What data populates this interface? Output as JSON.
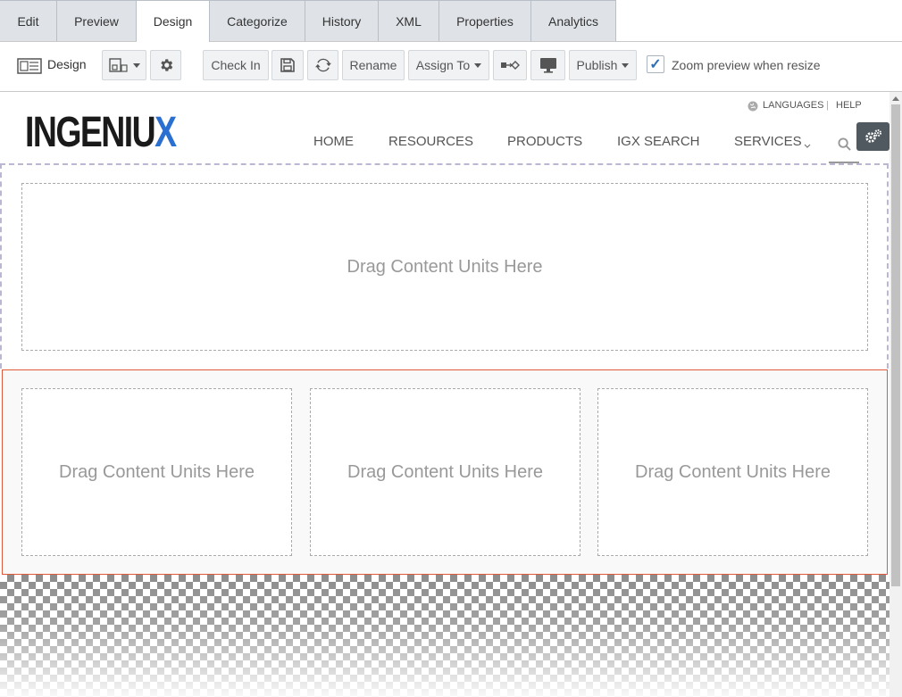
{
  "tabs": [
    {
      "label": "Edit",
      "active": false
    },
    {
      "label": "Preview",
      "active": false
    },
    {
      "label": "Design",
      "active": true
    },
    {
      "label": "Categorize",
      "active": false
    },
    {
      "label": "History",
      "active": false
    },
    {
      "label": "XML",
      "active": false
    },
    {
      "label": "Properties",
      "active": false
    },
    {
      "label": "Analytics",
      "active": false
    }
  ],
  "toolbar": {
    "design_label": "Design",
    "check_in": "Check In",
    "rename": "Rename",
    "assign_to": "Assign To",
    "publish": "Publish",
    "zoom_checkbox_checked": true,
    "zoom_label": "Zoom preview when resize"
  },
  "site": {
    "logo_main": "INGENIU",
    "logo_accent": "X",
    "logo_accent_color": "#2b6fd1",
    "languages": "LANGUAGES",
    "separator": "|",
    "help": "HELP",
    "nav": [
      "HOME",
      "RESOURCES",
      "PRODUCTS",
      "IGX SEARCH",
      "SERVICES"
    ]
  },
  "dropzones": {
    "top": "Drag Content Units Here",
    "col1": "Drag Content Units Here",
    "col2": "Drag Content Units Here",
    "col3": "Drag Content Units Here"
  },
  "colors": {
    "tab_bg": "#dfe3e8",
    "selected_row_border": "#e05a3a",
    "frame_dash": "#b9b7d4"
  }
}
